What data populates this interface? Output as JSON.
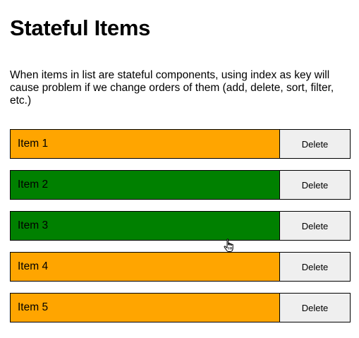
{
  "page": {
    "title": "Stateful Items",
    "description": "When items in list are stateful components, using index as key will cause problem if we change orders of them (add, delete, sort, filter, etc.)"
  },
  "items": [
    {
      "label": "Item 1",
      "color": "#ffa500",
      "delete_label": "Delete"
    },
    {
      "label": "Item 2",
      "color": "#008000",
      "delete_label": "Delete"
    },
    {
      "label": "Item 3",
      "color": "#008000",
      "delete_label": "Delete"
    },
    {
      "label": "Item 4",
      "color": "#ffa500",
      "delete_label": "Delete"
    },
    {
      "label": "Item 5",
      "color": "#ffa500",
      "delete_label": "Delete"
    }
  ],
  "cursor": {
    "icon": "hand-pointer-icon"
  }
}
